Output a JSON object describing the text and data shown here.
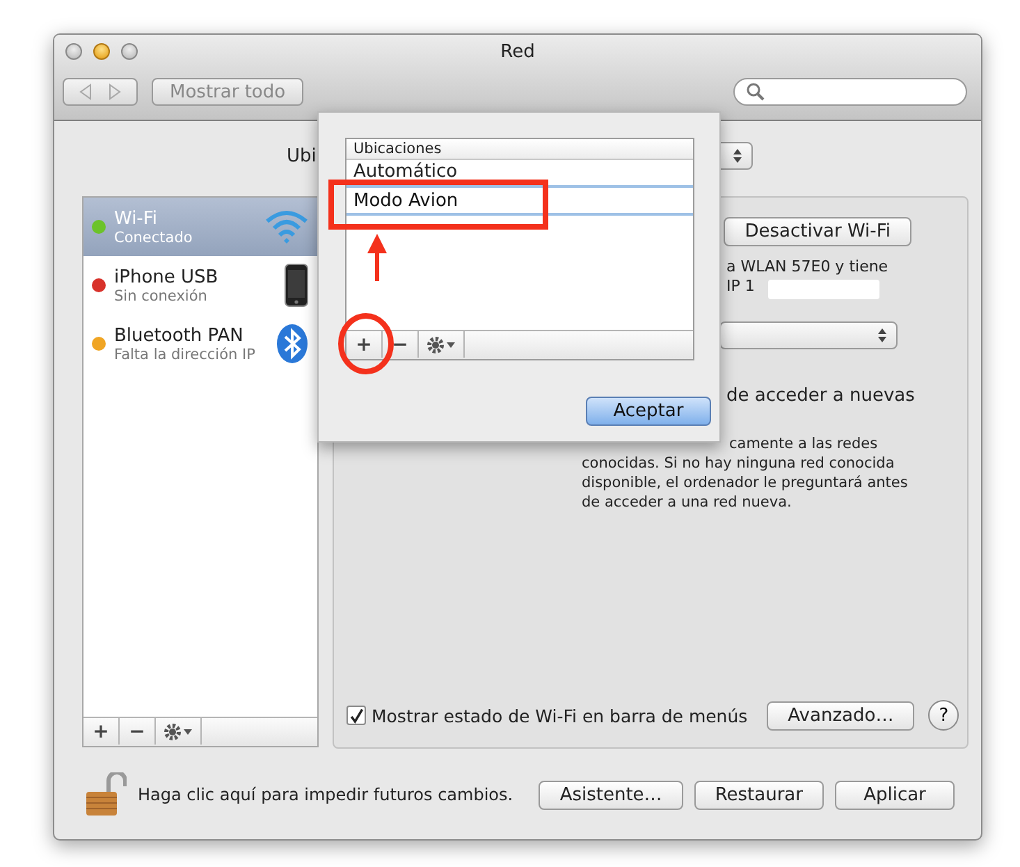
{
  "window": {
    "title": "Red"
  },
  "toolbar": {
    "show_all_button": "Mostrar todo"
  },
  "location": {
    "label": "Ubi"
  },
  "services": [
    {
      "name": "Wi-Fi",
      "status": "Conectado",
      "color": "#6cc32a",
      "selected": true,
      "kind": "wifi"
    },
    {
      "name": "iPhone USB",
      "status": "Sin conexión",
      "color": "#d8322b",
      "selected": false,
      "kind": "phone"
    },
    {
      "name": "Bluetooth PAN",
      "status": "Falta la dirección IP",
      "color": "#f0a524",
      "selected": false,
      "kind": "bluetooth"
    }
  ],
  "service_list_buttons": [
    "+",
    "−"
  ],
  "wifi_panel": {
    "toggle_button": "Desactivar Wi-Fi",
    "status_lines": [
      "a WLAN  57E0 y tiene",
      "IP 1"
    ],
    "ask_label": "de acceder a nuevas",
    "ask_description": "camente a las redes conocidas. Si no hay ninguna red conocida disponible, el ordenador le preguntará antes de acceder a una red nueva.",
    "menu_checkbox": {
      "label": "Mostrar estado de Wi-Fi en barra de menús",
      "checked": true
    },
    "advanced_button": "Avanzado…",
    "help_button": "?"
  },
  "lock": {
    "text": "Haga clic aquí para impedir futuros cambios."
  },
  "buttons": [
    "Asistente…",
    "Restaurar",
    "Aplicar"
  ],
  "sheet": {
    "column": "Ubicaciones",
    "locations": [
      {
        "name": "Automático"
      }
    ],
    "editing_value": "Modo Avion",
    "list_buttons": [
      "+",
      "−"
    ],
    "ok_button": "Aceptar"
  }
}
